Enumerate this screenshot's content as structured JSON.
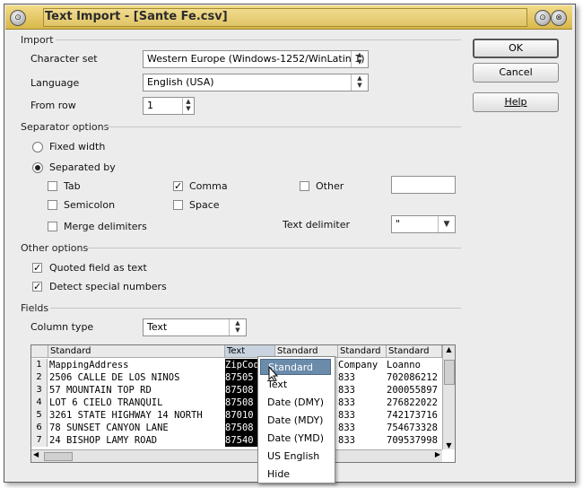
{
  "window": {
    "title": "Text Import - [Sante Fe.csv]",
    "menu_icon": "window-menu-icon",
    "controls": [
      "minimize-icon",
      "close-icon"
    ]
  },
  "import": {
    "section_label": "Import",
    "charset_label": "Character set",
    "charset_value": "Western Europe (Windows-1252/WinLatin 1)",
    "language_label": "Language",
    "language_value": "English (USA)",
    "fromrow_label": "From row",
    "fromrow_value": "1"
  },
  "buttons": {
    "ok": "OK",
    "cancel": "Cancel",
    "help": "Help"
  },
  "separator": {
    "section_label": "Separator options",
    "fixed_width": "Fixed width",
    "separated_by": "Separated by",
    "selected_mode": "separated_by",
    "tab": "Tab",
    "tab_checked": false,
    "comma": "Comma",
    "comma_checked": true,
    "other": "Other",
    "other_checked": false,
    "other_value": "",
    "semicolon": "Semicolon",
    "semicolon_checked": false,
    "space": "Space",
    "space_checked": false,
    "merge": "Merge delimiters",
    "merge_checked": false,
    "text_delimiter_label": "Text delimiter",
    "text_delimiter_value": "\""
  },
  "other_options": {
    "section_label": "Other options",
    "quoted": "Quoted field as text",
    "quoted_checked": true,
    "detect": "Detect special numbers",
    "detect_checked": true
  },
  "fields": {
    "section_label": "Fields",
    "column_type_label": "Column type",
    "column_type_value": "Text",
    "headers": [
      "Standard",
      "Text",
      "Standard",
      "Standard",
      "Standard"
    ],
    "row_numbers": [
      "1",
      "2",
      "3",
      "4",
      "5",
      "6",
      "7"
    ],
    "col1": [
      "MappingAddress",
      "2506  CALLE DE LOS NINOS",
      "57  MOUNTAIN TOP RD",
      "LOT 6  CIELO TRANQUIL",
      "3261  STATE HIGHWAY 14 NORTH",
      "78  SUNSET CANYON LANE",
      "24  BISHOP LAMY ROAD"
    ],
    "col2": [
      "ZipCod",
      "87505",
      "87508",
      "87508",
      "87010",
      "87508",
      "87540"
    ],
    "col4": [
      "Company",
      "833",
      "833",
      "833",
      "833",
      "833",
      "833"
    ],
    "col5": [
      "Loanno",
      "702086212",
      "200055897",
      "276822022",
      "742173716",
      "754673328",
      "709537998"
    ]
  },
  "dropdown_menu": {
    "items": [
      "Standard",
      "Text",
      "Date (DMY)",
      "Date (MDY)",
      "Date (YMD)",
      "US English",
      "Hide"
    ],
    "selected": "Standard"
  }
}
